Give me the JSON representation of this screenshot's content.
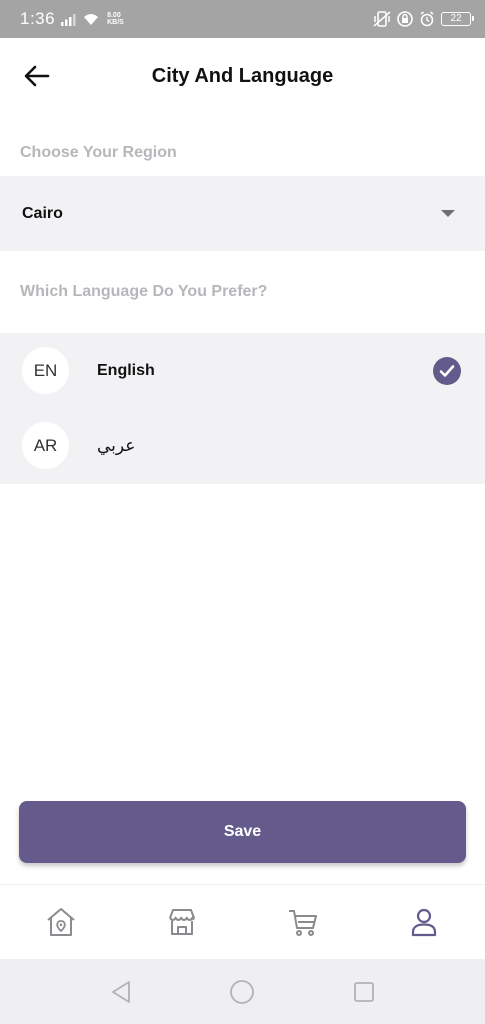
{
  "status_bar": {
    "time": "1:36",
    "net_speed_value": "8.00",
    "net_speed_unit": "KB/S",
    "battery": "22"
  },
  "header": {
    "title": "City And Language"
  },
  "region": {
    "label": "Choose Your Region",
    "selected": "Cairo"
  },
  "language": {
    "label": "Which Language Do You Prefer?",
    "options": [
      {
        "code": "EN",
        "name": "English",
        "selected": true
      },
      {
        "code": "AR",
        "name": "عربي",
        "selected": false
      }
    ]
  },
  "actions": {
    "save_label": "Save"
  },
  "bottom_nav": {
    "items": [
      {
        "icon": "home-icon",
        "active": false
      },
      {
        "icon": "store-icon",
        "active": false
      },
      {
        "icon": "cart-icon",
        "active": false
      },
      {
        "icon": "profile-icon",
        "active": true
      }
    ]
  },
  "colors": {
    "accent": "#645b8c",
    "inactive_icon": "#8a8a8f",
    "panel_bg": "#f2f2f5",
    "section_label": "#b7b7bb"
  }
}
